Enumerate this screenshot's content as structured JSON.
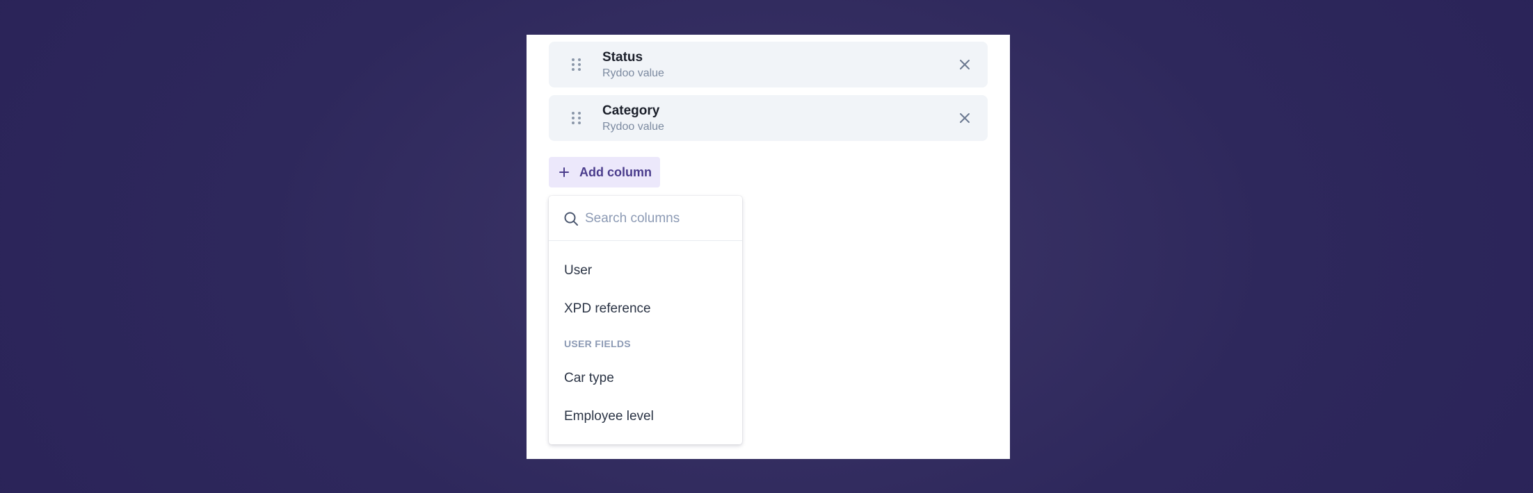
{
  "columns": [
    {
      "title": "Status",
      "subtitle": "Rydoo value"
    },
    {
      "title": "Category",
      "subtitle": "Rydoo value"
    }
  ],
  "add_column": {
    "label": "Add column",
    "icon": "plus-icon"
  },
  "dropdown": {
    "search_placeholder": "Search columns",
    "options": [
      "User",
      "XPD reference"
    ],
    "group": {
      "header": "USER FIELDS",
      "options": [
        "Car type",
        "Employee level"
      ]
    }
  },
  "colors": {
    "background": "#2e285c",
    "card": "#f1f4f8",
    "accent": "#4a3c8c",
    "accent_bg": "#ece8fb",
    "muted": "#7c8aa0"
  }
}
